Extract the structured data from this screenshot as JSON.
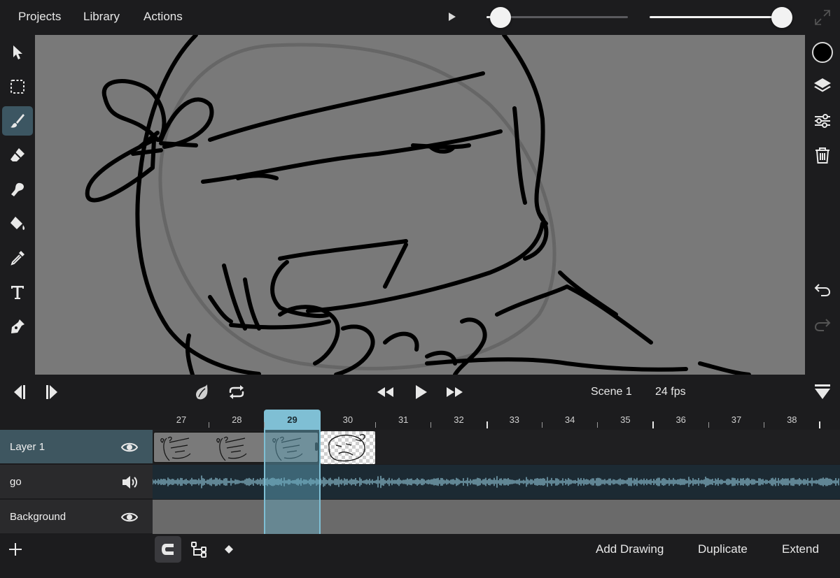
{
  "menu": {
    "projects": "Projects",
    "library": "Library",
    "actions": "Actions"
  },
  "top_controls": {
    "play_icon": "play-icon",
    "opacity_slider_value": 0.1,
    "size_slider_value": 1.0,
    "expand_icon": "expand-icon"
  },
  "left_tools": [
    {
      "name": "select-arrow-icon",
      "active": false
    },
    {
      "name": "marquee-select-icon",
      "active": false
    },
    {
      "name": "brush-icon",
      "active": true
    },
    {
      "name": "eraser-icon",
      "active": false
    },
    {
      "name": "smudge-icon",
      "active": false
    },
    {
      "name": "fill-bucket-icon",
      "active": false
    },
    {
      "name": "eyedropper-icon",
      "active": false
    },
    {
      "name": "text-icon",
      "active": false
    },
    {
      "name": "pen-icon",
      "active": false
    }
  ],
  "right_tools": {
    "color": "#000000",
    "layers_icon": "layers-icon",
    "adjustments_icon": "sliders-icon",
    "trash_icon": "trash-icon",
    "undo_icon": "undo-icon",
    "redo_icon": "redo-icon"
  },
  "transport": {
    "scene": "Scene 1",
    "fps": "24 fps",
    "onion_icon": "onion-skin-icon",
    "loop_icon": "loop-icon"
  },
  "ruler": {
    "frames": [
      "27",
      "28",
      "29",
      "30",
      "31",
      "32",
      "33",
      "34",
      "35",
      "36",
      "37",
      "38"
    ],
    "current": "29"
  },
  "layers": [
    {
      "name": "Layer 1",
      "icon": "eye-icon",
      "selected": true
    },
    {
      "name": "go",
      "icon": "speaker-icon",
      "selected": false
    },
    {
      "name": "Background",
      "icon": "eye-icon",
      "selected": false
    }
  ],
  "bottom": {
    "add_drawing": "Add Drawing",
    "duplicate": "Duplicate",
    "extend": "Extend"
  },
  "colors": {
    "accent": "#7fbfd4",
    "selected_layer": "#3e5660",
    "canvas": "#797979"
  }
}
